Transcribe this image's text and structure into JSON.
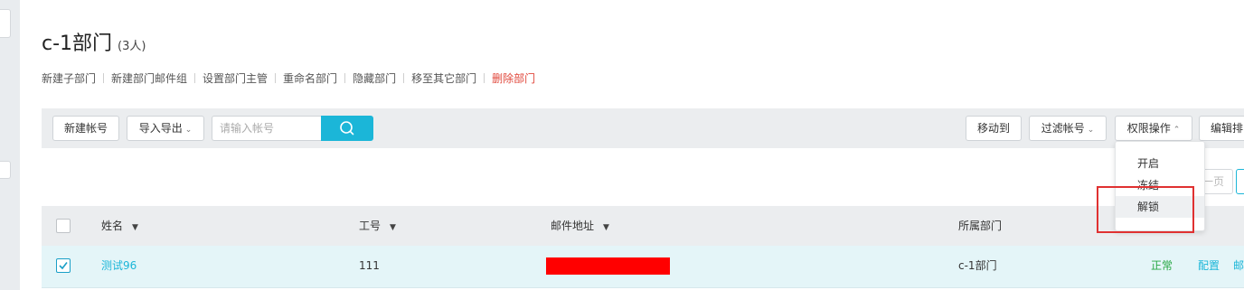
{
  "page": {
    "dept_name": "c-1部门",
    "member_count": "(3人)"
  },
  "dept_actions": {
    "new_sub_dept": "新建子部门",
    "new_mail_group": "新建部门邮件组",
    "set_manager": "设置部门主管",
    "rename": "重命名部门",
    "hide": "隐藏部门",
    "move_to": "移至其它部门",
    "delete": "删除部门"
  },
  "toolbar": {
    "new_account": "新建帐号",
    "import_export": "导入导出",
    "search_placeholder": "请输入帐号",
    "move_to": "移动到",
    "filter_account": "过滤帐号",
    "permission_ops": "权限操作",
    "edit_sort": "编辑排"
  },
  "permission_menu": {
    "items": [
      "开启",
      "冻结",
      "解锁"
    ],
    "highlighted": "解锁"
  },
  "pagination": {
    "prev_label": "一页"
  },
  "table": {
    "columns": [
      "姓名",
      "工号",
      "邮件地址",
      "所属部门"
    ],
    "rows": [
      {
        "checked": true,
        "name": "测试96",
        "employee_id": "111",
        "email": "",
        "department": "c-1部门",
        "status": "正常",
        "action_config": "配置",
        "action_mail": "邮件"
      }
    ]
  },
  "colors": {
    "accent": "#1bb6d8",
    "danger": "#e0473b",
    "status_ok": "#27a844",
    "redaction": "#ff0000"
  }
}
